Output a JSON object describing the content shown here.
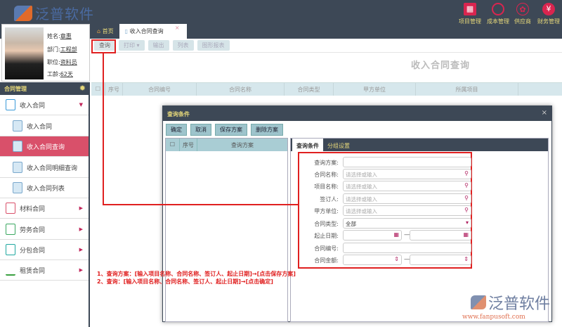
{
  "header": {
    "logo": "泛普软件",
    "nav": [
      {
        "label": "项目管理",
        "icon": "building-icon"
      },
      {
        "label": "成本管理",
        "icon": "pie-chart-icon"
      },
      {
        "label": "供应商",
        "icon": "medal-icon"
      },
      {
        "label": "财务管理",
        "icon": "yen-icon"
      }
    ]
  },
  "profile": {
    "name_label": "姓名:",
    "name": "章惠",
    "dept_label": "部门:",
    "dept": "工程部",
    "position_label": "职位:",
    "position": "资料员",
    "tenure_label": "工龄:",
    "tenure": "62天"
  },
  "sidebar": {
    "title": "合同管理",
    "items": [
      {
        "label": "收入合同"
      },
      {
        "label": "收入合同"
      },
      {
        "label": "收入合同查询"
      },
      {
        "label": "收入合同明细查询"
      },
      {
        "label": "收入合同列表"
      },
      {
        "label": "材料合同"
      },
      {
        "label": "劳务合同"
      },
      {
        "label": "分包合同"
      },
      {
        "label": "租赁合同"
      }
    ]
  },
  "tabs": {
    "home": "首页",
    "current": "收入合同查询",
    "close": "×"
  },
  "toolbar": {
    "query": "查询",
    "print": "打印 ▾",
    "export": "输出",
    "list": "列表",
    "chart_report": "图形报表"
  },
  "page_title": "收入合同查询",
  "grid": {
    "columns": [
      "序号",
      "合同编号",
      "合同名称",
      "合同类型",
      "甲方单位",
      "所属项目"
    ]
  },
  "dialog": {
    "title": "查询条件",
    "close": "×",
    "buttons": {
      "ok": "确定",
      "cancel": "取消",
      "save": "保存方案",
      "delete": "删除方案"
    },
    "left_columns": [
      "序号",
      "查询方案"
    ],
    "tabs": [
      "查询条件",
      "分组设置"
    ],
    "form": {
      "scheme_label": "查询方案:",
      "contract_name_label": "合同名称:",
      "project_name_label": "项目名称:",
      "signer_label": "签订人:",
      "party_a_label": "甲方单位:",
      "type_label": "合同类型:",
      "type_value": "全部",
      "date_label": "起止日期:",
      "number_label": "合同编号:",
      "amount_label": "合同金额:",
      "placeholder": "请选择或输入",
      "range_sep": "—"
    }
  },
  "annotation": {
    "line1": "1、查询方案：[输入项目名称、合同名称、签订人、起止日期]→[点击保存方案]",
    "line2": "2、查询：[输入项目名称、合同名称、签订人、起止日期]→[点击确定]"
  },
  "watermark": {
    "brand": "泛普软件",
    "url": "www.fanpusoft.com"
  }
}
